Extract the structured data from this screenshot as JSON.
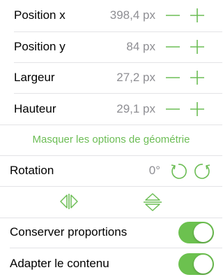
{
  "accent_color": "#6cbd55",
  "geometry": {
    "rows": [
      {
        "label": "Position x",
        "value": "398,4 px"
      },
      {
        "label": "Position y",
        "value": "84 px"
      },
      {
        "label": "Largeur",
        "value": "27,2 px"
      },
      {
        "label": "Hauteur",
        "value": "29,1 px"
      }
    ],
    "hide_options_label": "Masquer les options de géométrie"
  },
  "rotation": {
    "label": "Rotation",
    "value": "0°"
  },
  "flip": {
    "horizontal_icon": "flip-horizontal-icon",
    "vertical_icon": "flip-vertical-icon"
  },
  "toggles": [
    {
      "label": "Conserver proportions",
      "on": true
    },
    {
      "label": "Adapter le contenu",
      "on": true
    }
  ]
}
